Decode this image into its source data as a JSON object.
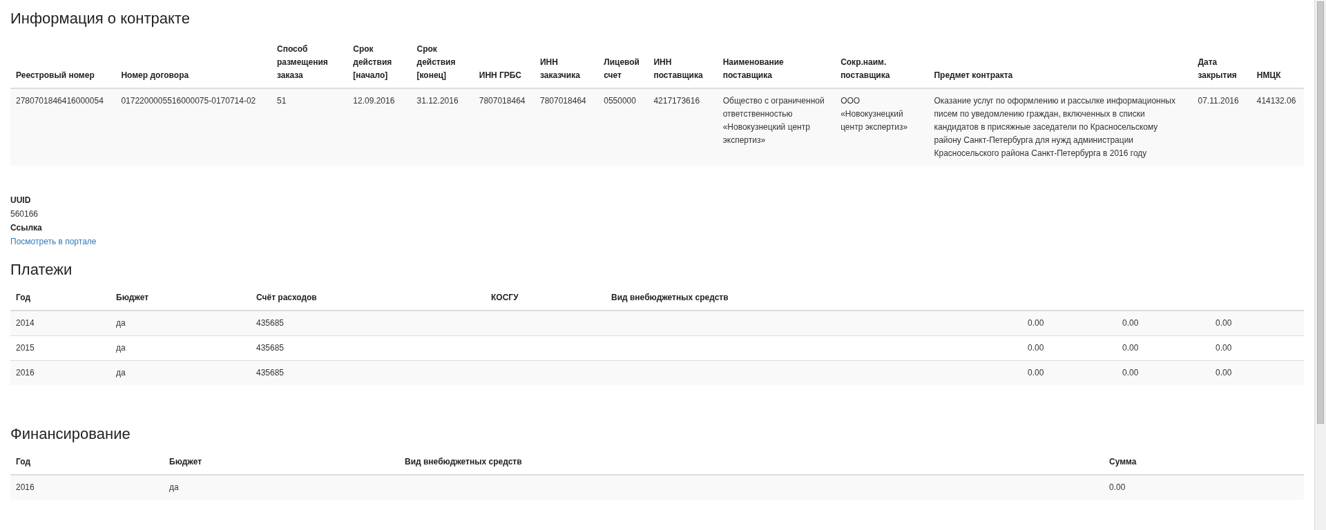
{
  "contract": {
    "title": "Информация о контракте",
    "columns": [
      "Реестровый номер",
      "Номер договора",
      "Способ размещения заказа",
      "Срок действия [начало]",
      "Срок действия [конец]",
      "ИНН ГРБС",
      "ИНН заказчика",
      "Лицевой счет",
      "ИНН поставщика",
      "Наименование поставщика",
      "Сокр.наим. поставщика",
      "Предмет контракта",
      "Дата закрытия",
      "НМЦК"
    ],
    "rows": [
      [
        "2780701846416000054",
        "0172200005516000075-0170714-02",
        "51",
        "12.09.2016",
        "31.12.2016",
        "7807018464",
        "7807018464",
        "0550000",
        "4217173616",
        "Общество с ограниченной ответственностью «Новокузнецкий центр экспертиз»",
        "ООО «Новокузнецкий центр экспертиз»",
        "Оказание услуг по оформлению и рассылке информационных писем по уведомлению граждан, включенных в списки кандидатов в присяжные заседатели по Красносельскому району Санкт-Петербурга для нужд администрации Красносельского района Санкт-Петербурга в 2016 году",
        "07.11.2016",
        "414132.06"
      ]
    ]
  },
  "details": [
    {
      "term": "UUID",
      "value": "560166",
      "kind": "text"
    },
    {
      "term": "Ссылка",
      "value": "Посмотреть в портале",
      "kind": "link"
    }
  ],
  "payments": {
    "title": "Платежи",
    "columns": [
      "Год",
      "Бюджет",
      "Счёт расходов",
      "КОСГУ",
      "Вид внебюджетных средств"
    ],
    "rows": [
      {
        "year": "2014",
        "budget": "да",
        "expense_account": "435685",
        "amounts": [
          "0.00",
          "0.00",
          "0.00"
        ]
      },
      {
        "year": "2015",
        "budget": "да",
        "expense_account": "435685",
        "amounts": [
          "0.00",
          "0.00",
          "0.00"
        ]
      },
      {
        "year": "2016",
        "budget": "да",
        "expense_account": "435685",
        "amounts": [
          "0.00",
          "0.00",
          "0.00"
        ]
      }
    ]
  },
  "financing": {
    "title": "Финансирование",
    "columns": [
      "Год",
      "Бюджет",
      "Вид внебюджетных средств",
      "Сумма"
    ],
    "rows": [
      {
        "year": "2016",
        "budget": "да",
        "amount": "0.00"
      }
    ]
  }
}
